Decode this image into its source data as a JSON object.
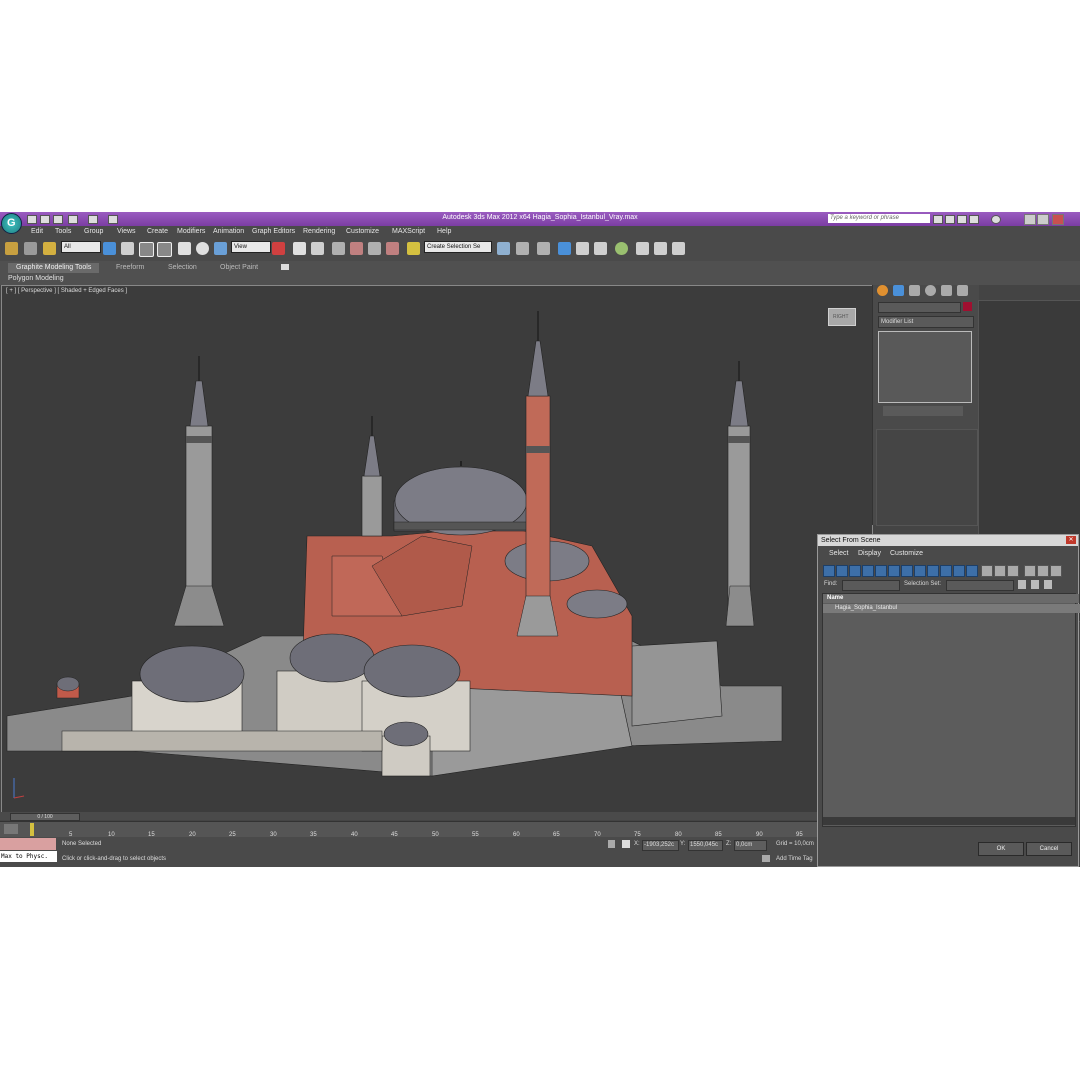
{
  "app": {
    "title": "Autodesk 3ds Max  2012 x64      Hagia_Sophia_Istanbul_Vray.max",
    "search_placeholder": "Type a keyword or phrase"
  },
  "menu": [
    "Edit",
    "Tools",
    "Group",
    "Views",
    "Create",
    "Modifiers",
    "Animation",
    "Graph Editors",
    "Rendering",
    "Customize",
    "MAXScript",
    "Help"
  ],
  "toolbar": {
    "filter_value": "All",
    "refcoord_value": "View",
    "selection_set_value": "Create Selection Se"
  },
  "ribbon": {
    "tabs": [
      "Graphite Modeling Tools",
      "Freeform",
      "Selection",
      "Object Paint"
    ],
    "sub_label": "Polygon Modeling"
  },
  "viewport": {
    "label": "[ + ] [ Perspective ] [ Shaded + Edged Faces ]",
    "viewcube_label": "RIGHT"
  },
  "command_panel": {
    "modifier_list_label": "Modifier List",
    "object_color": "#a01030"
  },
  "dialog": {
    "title": "Select From Scene",
    "menu": [
      "Select",
      "Display",
      "Customize"
    ],
    "find_label": "Find:",
    "selection_set_label": "Selection Set:",
    "column_header": "Name",
    "items": [
      "Hagia_Sophia_Istanbul"
    ],
    "ok_label": "OK",
    "cancel_label": "Cancel"
  },
  "timeline": {
    "frame_display": "0 / 100",
    "ticks": [
      "5",
      "10",
      "15",
      "20",
      "25",
      "30",
      "35",
      "40",
      "45",
      "50",
      "55",
      "60",
      "65",
      "70",
      "75",
      "80",
      "85",
      "90",
      "95"
    ]
  },
  "status": {
    "maxscript_text": "Max to Physc.",
    "selection_status": "None Selected",
    "prompt": "Click or click-and-drag to select objects",
    "x_label": "X:",
    "x_value": "-1903,252c",
    "y_label": "Y:",
    "y_value": "1550,045c",
    "z_label": "Z:",
    "z_value": "0,0cm",
    "grid": "Grid = 10,0cm",
    "add_time_tag": "Add Time Tag"
  }
}
